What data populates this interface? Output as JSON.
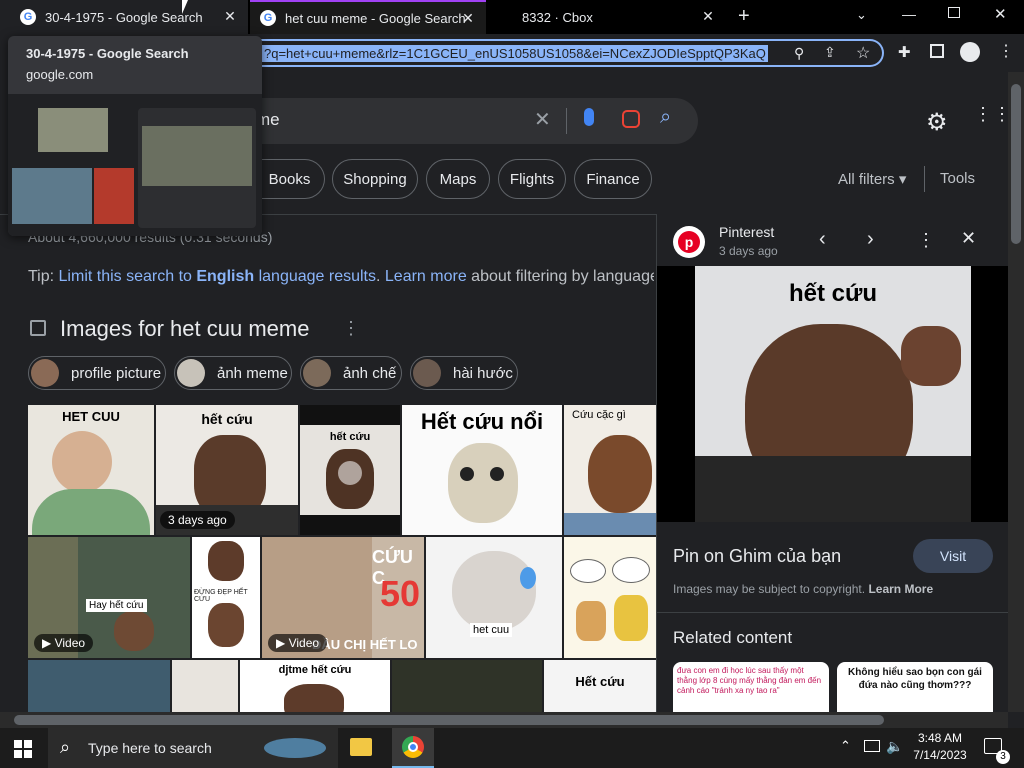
{
  "tabs": [
    {
      "title": "30-4-1975 - Google Search"
    },
    {
      "title": "het cuu meme - Google Search"
    },
    {
      "title": "8332 · Cbox"
    }
  ],
  "omnibox": {
    "url": "?q=het+cuu+meme&rlz=1C1GCEU_enUS1058US1058&ei=NCexZJODIeSpptQP3KaQ"
  },
  "hover_card": {
    "title": "30-4-1975 - Google Search",
    "domain": "google.com"
  },
  "search": {
    "query": "me"
  },
  "filters": [
    "Books",
    "Shopping",
    "Maps",
    "Flights",
    "Finance"
  ],
  "all_filters_label": "All filters",
  "tools_label": "Tools",
  "results_stats": "About 4,660,000 results (0.31 seconds)",
  "tip": {
    "prefix": "Tip: ",
    "link1": "Limit this search to ",
    "link1_bold": "English",
    "link1_rest": " language results",
    "dot": ". ",
    "link2": "Learn more",
    "suffix": " about filtering by language"
  },
  "images_heading": "Images for het cuu meme",
  "related_chips": [
    "profile picture",
    "ảnh meme",
    "ảnh chế",
    "hài hước"
  ],
  "thumbs": {
    "t1_title": "HET CUU",
    "t2_title": "hết cứu",
    "t2_badge": "3 days ago",
    "t3_title": "hết cứu",
    "t4_title": "Hết cứu nổi",
    "t5_title": "Cứu cặc gì",
    "t6_label": "Hay hết cứu",
    "t6_badge": "Video",
    "t7_label": "ĐỪNG ĐẸP HẾT CỨU",
    "t8_big": "CỨU C",
    "t8_num": "50",
    "t8_bottom": "ĐẦU CHỊ HẾT LO",
    "t8_badge": "Video",
    "t9_label": "het cuu",
    "b3_title": "djtme hết cứu",
    "b5_title": "Hết cứu"
  },
  "panel": {
    "source": "Pinterest",
    "age": "3 days ago",
    "image_title": "hết cứu",
    "pin_title": "Pin on Ghim của bạn",
    "visit_label": "Visit",
    "copyright": "Images may be subject to copyright.",
    "learn_more": "Learn More",
    "related_heading": "Related content",
    "related1": "đưa con em đi học lúc sau thấy một thằng lớp 8 cùng mấy thằng đàn em đến cảnh cáo \"tránh xa ny tao ra\"",
    "related2": "Không hiểu sao bọn con gái đứa nào cũng thơm???"
  },
  "taskbar": {
    "search_placeholder": "Type here to search",
    "time": "3:48 AM",
    "date": "7/14/2023",
    "notifications": "3"
  },
  "colors": {
    "accent": "#8ab4f8",
    "background": "#202124",
    "surface": "#303134",
    "pinterest": "#e60023"
  }
}
